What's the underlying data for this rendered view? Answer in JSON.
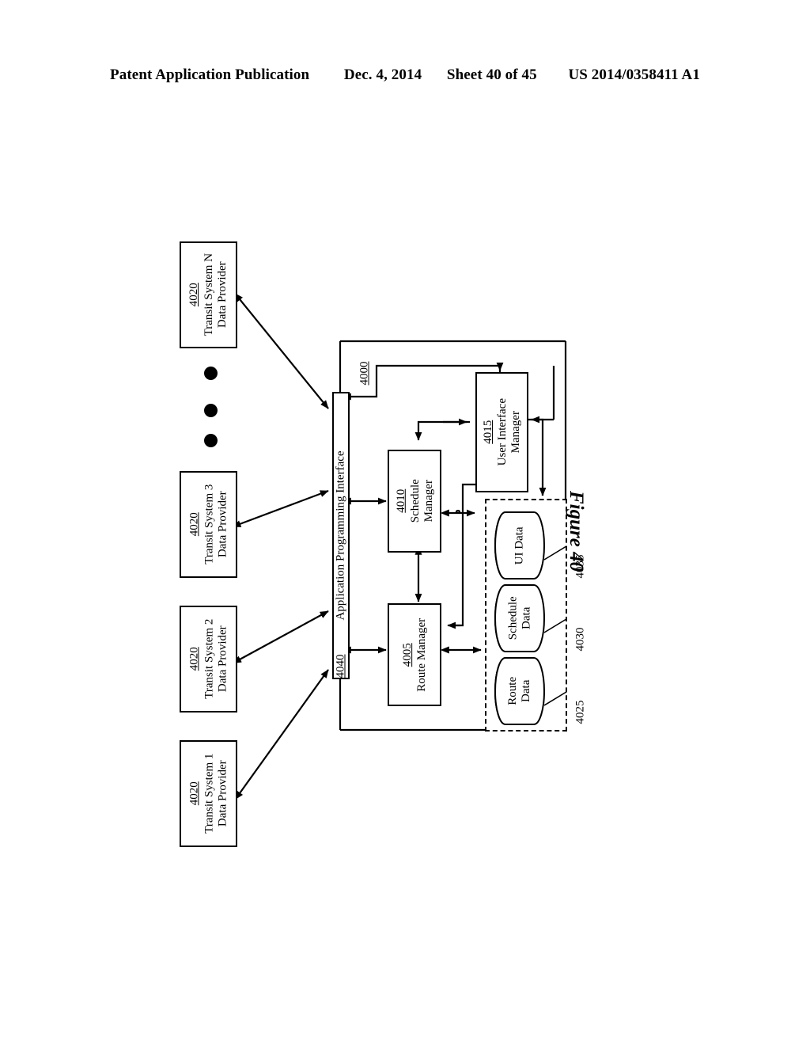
{
  "header": {
    "publication": "Patent Application Publication",
    "date": "Dec. 4, 2014",
    "sheet": "Sheet 40 of 45",
    "doc_number": "US 2014/0358411 A1"
  },
  "figure": {
    "caption": "Figure 40",
    "system_ref": "4000"
  },
  "providers": [
    {
      "ref": "4020",
      "line1": "Transit System N",
      "line2": "Data Provider"
    },
    {
      "ref": "4020",
      "line1": "Transit System 3",
      "line2": "Data Provider"
    },
    {
      "ref": "4020",
      "line1": "Transit System 2",
      "line2": "Data Provider"
    },
    {
      "ref": "4020",
      "line1": "Transit System 1",
      "line2": "Data Provider"
    }
  ],
  "api": {
    "ref": "4040",
    "label": "Application Programming Interface"
  },
  "managers": [
    {
      "ref": "4015",
      "line1": "User Interface",
      "line2": "Manager"
    },
    {
      "ref": "4010",
      "line1": "Schedule",
      "line2": "Manager"
    },
    {
      "ref": "4005",
      "line1": "Route Manager",
      "line2": ""
    }
  ],
  "datastores": [
    {
      "ref": "4035",
      "line1": "UI Data",
      "line2": ""
    },
    {
      "ref": "4030",
      "line1": "Schedule",
      "line2": "Data"
    },
    {
      "ref": "4025",
      "line1": "Route",
      "line2": "Data"
    }
  ],
  "colors": {
    "ink": "#000000",
    "paper": "#ffffff"
  }
}
